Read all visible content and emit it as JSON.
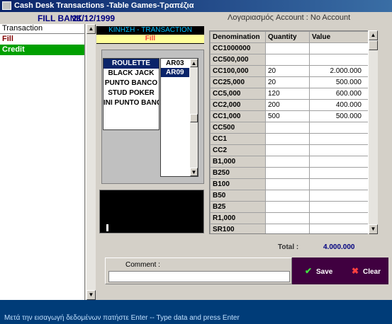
{
  "window": {
    "title": "Cash Desk Transactions  -Table Games-Τραπέζια"
  },
  "header": {
    "fill_label": "FILL BANK",
    "date": "21/12/1999",
    "account": "Λογαριασμός Account :  No Account"
  },
  "left_panel": {
    "header": "Transaction",
    "items": [
      "Fill",
      "Credit"
    ]
  },
  "kinisi": {
    "title": "ΚΙΝΗΣΗ - TRANSACTION",
    "value": "Fill"
  },
  "games": [
    "ROULETTE",
    "BLACK JACK",
    "PUNTO BANCO",
    "STUD POKER",
    "INI PUNTO BANC"
  ],
  "tables": [
    "AR03",
    "AR09"
  ],
  "grid": {
    "headers": [
      "Denomination",
      "Quantity",
      "Value"
    ],
    "rows": [
      {
        "den": "CC1000000",
        "qty": "",
        "val": ""
      },
      {
        "den": "CC500,000",
        "qty": "",
        "val": ""
      },
      {
        "den": "CC100,000",
        "qty": "20",
        "val": "2.000.000"
      },
      {
        "den": "CC25,000",
        "qty": "20",
        "val": "500.000"
      },
      {
        "den": "CC5,000",
        "qty": "120",
        "val": "600.000"
      },
      {
        "den": "CC2,000",
        "qty": "200",
        "val": "400.000"
      },
      {
        "den": "CC1,000",
        "qty": "500",
        "val": "500.000"
      },
      {
        "den": "CC500",
        "qty": "",
        "val": ""
      },
      {
        "den": "CC1",
        "qty": "",
        "val": ""
      },
      {
        "den": "CC2",
        "qty": "",
        "val": ""
      },
      {
        "den": "B1,000",
        "qty": "",
        "val": ""
      },
      {
        "den": "B250",
        "qty": "",
        "val": ""
      },
      {
        "den": "B100",
        "qty": "",
        "val": ""
      },
      {
        "den": "B50",
        "qty": "",
        "val": ""
      },
      {
        "den": "B25",
        "qty": "",
        "val": ""
      },
      {
        "den": "R1,000",
        "qty": "",
        "val": ""
      },
      {
        "den": "SR100",
        "qty": "",
        "val": ""
      }
    ]
  },
  "total": {
    "label": "Total :",
    "value": "4.000.000"
  },
  "comment": {
    "label": "Comment :",
    "value": ""
  },
  "buttons": {
    "save": "Save",
    "clear": "Clear"
  },
  "status": "Μετά την εισαγωγή δεδομένων πατήστε Enter -- Type data and press Enter",
  "colors": {
    "title_bar": "#0a246a",
    "status_bar": "#003c78",
    "button_panel": "#400040",
    "credit_row": "#00a000"
  }
}
